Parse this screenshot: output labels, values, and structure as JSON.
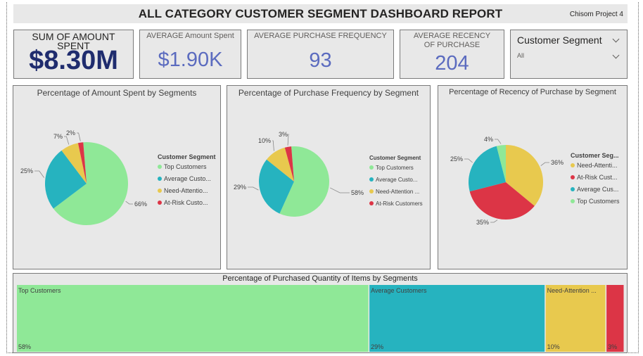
{
  "header": {
    "title": "ALL CATEGORY CUSTOMER SEGMENT DASHBOARD REPORT",
    "project": "Chisom Project 4"
  },
  "kpis": {
    "total_spent": {
      "label": "SUM OF AMOUNT SPENT",
      "value": "$8.30M"
    },
    "avg_spent": {
      "label": "AVERAGE Amount Spent",
      "value": "$1.90K"
    },
    "avg_frequency": {
      "label": "AVERAGE PURCHASE FREQUENCY",
      "value": "93"
    },
    "avg_recency": {
      "label": "AVERAGE RECENCY OF PURCHASE",
      "value": "204"
    }
  },
  "slicer": {
    "title": "Customer Segment",
    "value": "All"
  },
  "colors": {
    "top": "#8fe897",
    "average": "#26b3bf",
    "need": "#e8c94e",
    "atrisk": "#dc3546"
  },
  "chart_data": [
    {
      "type": "pie",
      "title": "Percentage of Amount Spent by Segments",
      "legend_title": "Customer Segment",
      "legend_labels": [
        "Top Customers",
        "Average Custo...",
        "Need-Attentio...",
        "At-Risk Custo..."
      ],
      "slices": [
        {
          "name": "Top Customers",
          "value": 66,
          "label": "66%",
          "color": "#8fe897"
        },
        {
          "name": "Average Customers",
          "value": 25,
          "label": "25%",
          "color": "#26b3bf"
        },
        {
          "name": "Need-Attention Customers",
          "value": 7,
          "label": "7%",
          "color": "#e8c94e"
        },
        {
          "name": "At-Risk Customers",
          "value": 2,
          "label": "2%",
          "color": "#dc3546"
        }
      ]
    },
    {
      "type": "pie",
      "title": "Percentage of Purchase Frequency by Segment",
      "legend_title": "Customer Segment",
      "legend_labels": [
        "Top Customers",
        "Average Custo...",
        "Need-Attention ...",
        "At-Risk Customers"
      ],
      "slices": [
        {
          "name": "Top Customers",
          "value": 58,
          "label": "58%",
          "color": "#8fe897"
        },
        {
          "name": "Average Customers",
          "value": 29,
          "label": "29%",
          "color": "#26b3bf"
        },
        {
          "name": "Need-Attention Customers",
          "value": 10,
          "label": "10%",
          "color": "#e8c94e"
        },
        {
          "name": "At-Risk Customers",
          "value": 3,
          "label": "3%",
          "color": "#dc3546"
        }
      ]
    },
    {
      "type": "pie",
      "title": "Percentage of Recency of Purchase by Segment",
      "legend_title": "Customer Seg...",
      "legend_labels": [
        "Need-Attenti...",
        "At-Risk Cust...",
        "Average Cus...",
        "Top Customers"
      ],
      "slices": [
        {
          "name": "Need-Attention Customers",
          "value": 36,
          "label": "36%",
          "color": "#e8c94e"
        },
        {
          "name": "At-Risk Customers",
          "value": 35,
          "label": "35%",
          "color": "#dc3546"
        },
        {
          "name": "Average Customers",
          "value": 25,
          "label": "25%",
          "color": "#26b3bf"
        },
        {
          "name": "Top Customers",
          "value": 4,
          "label": "4%",
          "color": "#8fe897"
        }
      ]
    },
    {
      "type": "treemap",
      "title": "Percentage of Purchased Quantity of Items by Segments",
      "cells": [
        {
          "name": "Top Customers",
          "value": 58,
          "label": "58%",
          "color": "#8fe897"
        },
        {
          "name": "Average Customers",
          "value": 29,
          "label": "29%",
          "color": "#26b3bf"
        },
        {
          "name": "Need-Attention ...",
          "value": 10,
          "label": "10%",
          "color": "#e8c94e"
        },
        {
          "name": "",
          "value": 3,
          "label": "3%",
          "color": "#dc3546"
        }
      ]
    }
  ]
}
